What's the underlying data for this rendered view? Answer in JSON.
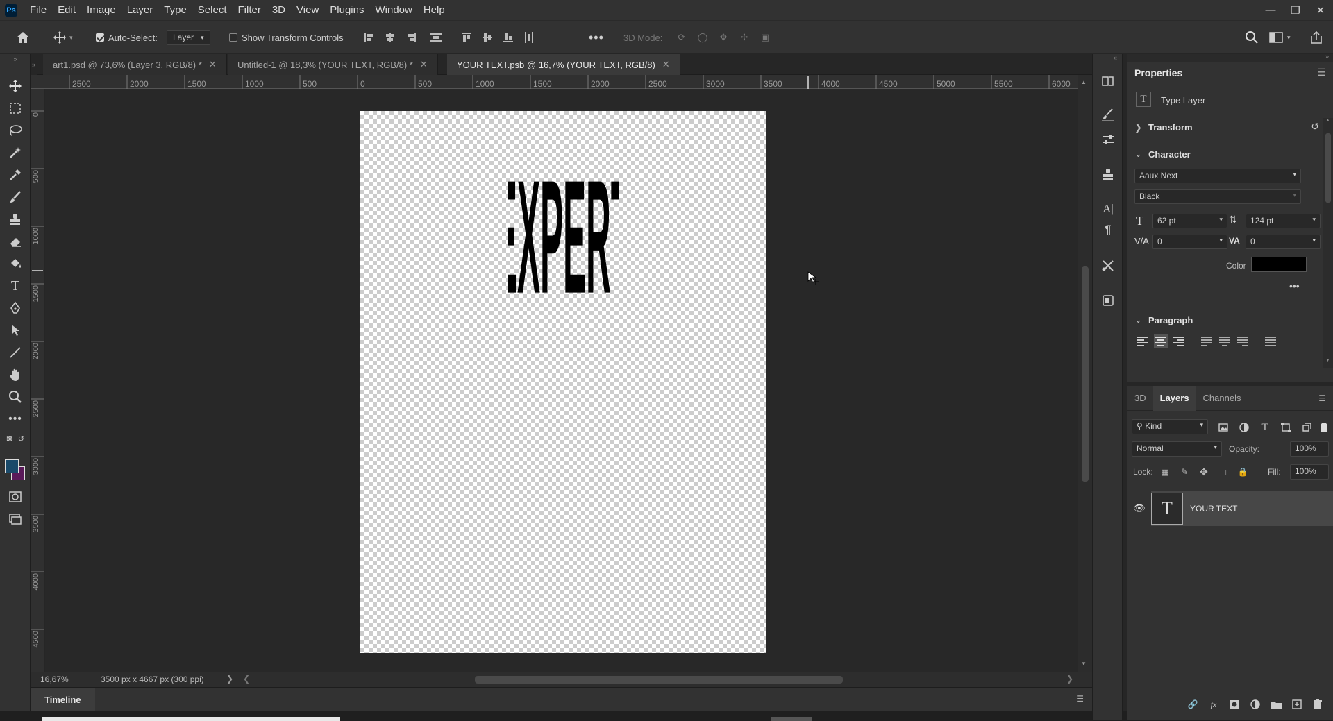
{
  "menubar": {
    "logo": "Ps",
    "items": [
      "File",
      "Edit",
      "Image",
      "Layer",
      "Type",
      "Select",
      "Filter",
      "3D",
      "View",
      "Plugins",
      "Window",
      "Help"
    ]
  },
  "optionsbar": {
    "auto_select_label": "Auto-Select:",
    "auto_select_value": "Layer",
    "show_transform_label": "Show Transform Controls",
    "mode_3d_label": "3D Mode:"
  },
  "tabs": [
    {
      "label": "art1.psd @ 73,6% (Layer 3, RGB/8) *"
    },
    {
      "label": "Untitled-1 @ 18,3% (YOUR TEXT, RGB/8) *"
    },
    {
      "label": "YOUR TEXT.psb @ 16,7% (YOUR TEXT, RGB/8)"
    }
  ],
  "ruler_h": [
    "2500",
    "2000",
    "1500",
    "1000",
    "500",
    "0",
    "500",
    "1000",
    "1500",
    "2000",
    "2500",
    "3000",
    "3500",
    "4000",
    "4500",
    "5000",
    "5500",
    "6000"
  ],
  "ruler_v": [
    "0",
    "500",
    "1000",
    "1500",
    "2000",
    "2500",
    "3000",
    "3500",
    "4000",
    "4500"
  ],
  "canvas_text": "EXPERT",
  "status": {
    "zoom": "16,67%",
    "doc_size": "3500 px x 4667 px (300 ppi)"
  },
  "timeline_label": "Timeline",
  "properties": {
    "title": "Properties",
    "layer_type": "Type Layer",
    "transform": "Transform",
    "character": "Character",
    "font_family": "Aaux Next",
    "font_style": "Black",
    "font_size": "62 pt",
    "leading": "124 pt",
    "kerning": "0",
    "tracking": "0",
    "color_label": "Color",
    "color": "#000000",
    "paragraph": "Paragraph"
  },
  "layers_panel": {
    "tabs": [
      "3D",
      "Layers",
      "Channels"
    ],
    "kind_label": "Kind",
    "blend_mode": "Normal",
    "opacity_label": "Opacity:",
    "opacity": "100%",
    "lock_label": "Lock:",
    "fill_label": "Fill:",
    "fill": "100%",
    "layers": [
      {
        "name": "YOUR TEXT",
        "thumb": "T"
      }
    ]
  },
  "colors": {
    "foreground": "#1a4a6a",
    "background": "#5a1a5a"
  }
}
